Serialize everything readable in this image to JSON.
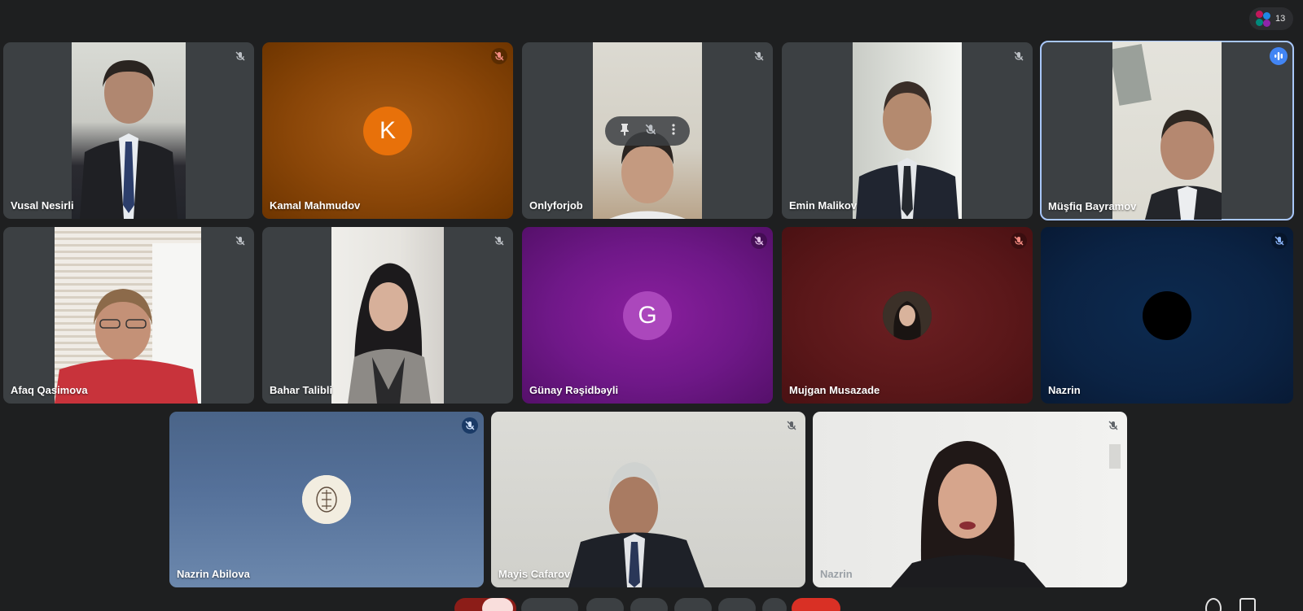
{
  "header": {
    "participant_count": "13"
  },
  "participants": [
    {
      "name": "Vusal Nesirli"
    },
    {
      "name": "Kamal Mahmudov",
      "initial": "K"
    },
    {
      "name": "Onlyforjob"
    },
    {
      "name": "Emin Malikov"
    },
    {
      "name": "Müşfiq Bayramov"
    },
    {
      "name": "Afaq Qasimova"
    },
    {
      "name": "Bahar Talibli"
    },
    {
      "name": "Günay Rəşidbəyli",
      "initial": "G"
    },
    {
      "name": "Mujgan Musazade"
    },
    {
      "name": "Nazrin"
    },
    {
      "name": "Nazrin Abilova"
    },
    {
      "name": "Mayis Cafarov"
    },
    {
      "name": "Nazrin"
    }
  ],
  "footer": {
    "clock": ""
  },
  "colors": {
    "background": "#1e1f20",
    "tile": "#3c4043",
    "active_outline": "#a8c7fa",
    "leave_button": "#d93025"
  },
  "icons": [
    "mic-off-icon",
    "pin-icon",
    "more-icon",
    "audio-level-icon",
    "people-icon"
  ]
}
